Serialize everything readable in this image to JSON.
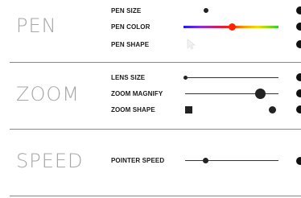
{
  "sections": [
    {
      "title": "PEN",
      "settings": [
        {
          "label": "PEN SIZE"
        },
        {
          "label": "PEN COLOR"
        },
        {
          "label": "PEN SHAPE"
        }
      ]
    },
    {
      "title": "ZOOM",
      "settings": [
        {
          "label": "LENS SIZE"
        },
        {
          "label": "ZOOM MAGNIFY"
        },
        {
          "label": "ZOOM SHAPE"
        }
      ]
    },
    {
      "title": "SPEED",
      "settings": [
        {
          "label": "POINTER SPEED"
        }
      ]
    }
  ],
  "colors": {
    "title": "#a6a6a6",
    "label": "#1a1a1a",
    "control": "#222222",
    "picker_accent": "#ff2200"
  },
  "icons": {
    "pen_shape": "arrow-cursor-icon",
    "zoom_shape_square": "square-icon",
    "zoom_shape_circle": "circle-icon"
  }
}
